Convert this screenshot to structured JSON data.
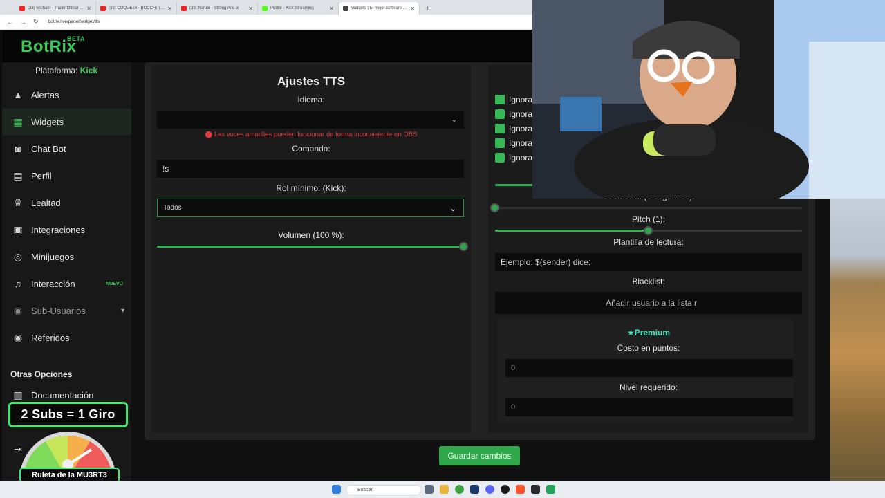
{
  "browser": {
    "tabs": [
      {
        "title": "(33) Michael - Trailer Oficial Do",
        "color": "#e22"
      },
      {
        "title": "(33) COQUETA - BOCCHI THE R",
        "color": "#e22"
      },
      {
        "title": "(33) Naruto - Strong And B",
        "color": "#e22"
      },
      {
        "title": "Profile - Kick Streaming",
        "color": "#53fc18"
      },
      {
        "title": "Widgets | El mejor software par",
        "color": "#444"
      }
    ],
    "new_tab": "+",
    "url": "botrix.live/panel/widget/tts"
  },
  "logo": {
    "name": "BotRix",
    "badge": "BETA"
  },
  "platform": {
    "label": "Plataforma:",
    "value": "Kick"
  },
  "nav": [
    {
      "label": "Alertas",
      "icon": "warning-icon"
    },
    {
      "label": "Widgets",
      "icon": "grid-icon"
    },
    {
      "label": "Chat Bot",
      "icon": "robot-icon"
    },
    {
      "label": "Perfil",
      "icon": "id-card-icon"
    },
    {
      "label": "Lealtad",
      "icon": "trophy-icon"
    },
    {
      "label": "Integraciones",
      "icon": "integration-icon"
    },
    {
      "label": "Minijuegos",
      "icon": "gamepad-icon"
    },
    {
      "label": "Interacción",
      "icon": "music-icon",
      "badge": "NUEVO"
    },
    {
      "label": "Sub-Usuarios",
      "icon": "users-icon"
    },
    {
      "label": "Referidos",
      "icon": "users-icon"
    }
  ],
  "other_options": {
    "title": "Otras Opciones",
    "items": [
      {
        "label": "Documentación"
      }
    ]
  },
  "left_panel": {
    "title": "Ajustes TTS",
    "language_label": "Idioma:",
    "language_value": "",
    "warning": "Las voces amarillas pueden funcionar de forma inconsistente en OBS",
    "command_label": "Comando:",
    "command_value": "!s",
    "role_label": "Rol mínimo: (Kick):",
    "role_value": "Todos",
    "volume_label": "Volumen (100 %):",
    "volume": 1.0
  },
  "right_panel": {
    "checks": [
      "Ignora",
      "Ignora",
      "Ignora",
      "Ignora",
      "Ignora"
    ],
    "cooldown_label": "Cooldown: (0 segundos):",
    "cooldown": 0,
    "pitch_label": "Pitch (1):",
    "pitch": 0.5,
    "template_label": "Plantilla de lectura:",
    "template_placeholder": "Ejemplo: $(sender) dice:",
    "blacklist_label": "Blacklist:",
    "blacklist_placeholder": "Añadir usuario a la lista r",
    "premium_label": "Premium",
    "points_label": "Costo en puntos:",
    "points_value": "0",
    "level_label": "Nivel requerido:",
    "level_value": "0"
  },
  "save_button": "Guardar cambios",
  "overlay": {
    "subs": "2 Subs = 1 Giro",
    "roulette": "Ruleta de la MU3RT3"
  },
  "taskbar": {
    "search": "Buscar"
  },
  "colors": {
    "accent": "#3ec95a",
    "warning": "#e23b3b",
    "premium": "#3ee0b8"
  }
}
